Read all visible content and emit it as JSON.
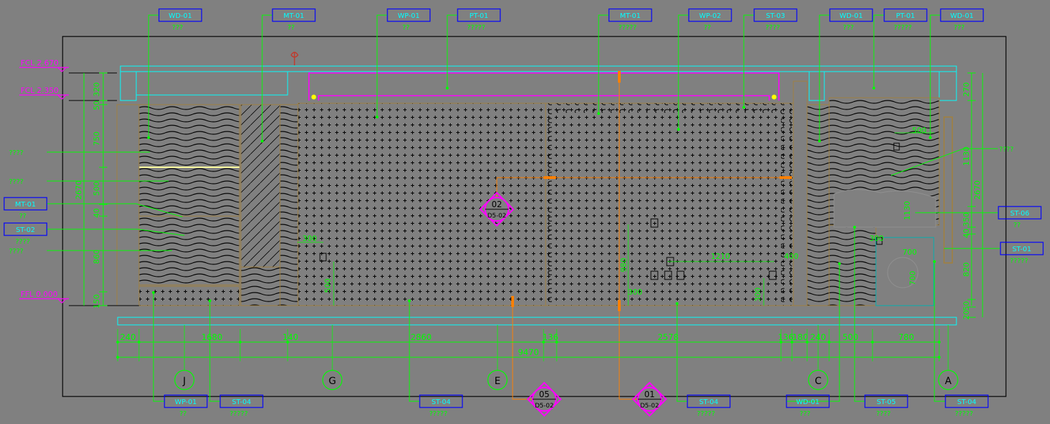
{
  "colors": {
    "background": "#808080",
    "frame": "#000000",
    "leader": "#00ff00",
    "tag_box": "#0000ff",
    "tag_text": "#00ffff",
    "level": "#ff00ff",
    "ceiling": "#00ffff",
    "grid_axis": "#ff8000",
    "wall_hatch": "#000000",
    "callout": "#ff00ff"
  },
  "top_tags": [
    {
      "code": "WD-01",
      "sub": "???"
    },
    {
      "code": "MT-01",
      "sub": "??"
    },
    {
      "code": "WP-01",
      "sub": "??"
    },
    {
      "code": "PT-01",
      "sub": "?????"
    },
    {
      "code": "MT-01",
      "sub": "?????"
    },
    {
      "code": "WP-02",
      "sub": "??"
    },
    {
      "code": "ST-03",
      "sub": "????"
    },
    {
      "code": "WD-01",
      "sub": "???"
    },
    {
      "code": "PT-01",
      "sub": "?????"
    },
    {
      "code": "WD-01",
      "sub": "???"
    }
  ],
  "bottom_tags": [
    {
      "code": "WP-01",
      "sub": "??"
    },
    {
      "code": "ST-04",
      "sub": "?????"
    },
    {
      "code": "ST-04",
      "sub": "?????"
    },
    {
      "code": "ST-04",
      "sub": "?????"
    },
    {
      "code": "WD-01",
      "sub": "???"
    },
    {
      "code": "ST-05",
      "sub": "????"
    },
    {
      "code": "ST-04",
      "sub": "?????"
    }
  ],
  "left_tags": [
    {
      "code": "MT-01",
      "sub": "??"
    },
    {
      "code": "ST-02",
      "sub": "????"
    }
  ],
  "right_tags": [
    {
      "code": "ST-06",
      "sub": "??"
    },
    {
      "code": "ST-01",
      "sub": "?????"
    }
  ],
  "left_notes": [
    "????",
    "????",
    "????"
  ],
  "right_notes": [
    "????"
  ],
  "levels": [
    {
      "label": "FCL 2.670"
    },
    {
      "label": "FCL 2.350"
    },
    {
      "label": "FFL 0.000"
    }
  ],
  "left_dims": [
    "320",
    "50",
    "750",
    "500",
    "40",
    "860",
    "150"
  ],
  "left_total": "2670",
  "right_dims": [
    "270",
    "1130",
    "350",
    "40",
    "820",
    "50",
    "20"
  ],
  "right_total": "2670",
  "bottom_dims": [
    "240",
    "1680",
    "140",
    "2860",
    "136",
    "2578",
    "136",
    "180",
    "240",
    "500",
    "780"
  ],
  "overall_dim": "9470",
  "inner_dims": [
    "300",
    "300",
    "500",
    "980",
    "1210",
    "400",
    "300",
    "300",
    "700",
    "700",
    "500",
    "1130"
  ],
  "grid_axes": [
    "J",
    "G",
    "E",
    "C",
    "A"
  ],
  "callouts": [
    {
      "num": "02",
      "sheet": "D5-02"
    },
    {
      "num": "05",
      "sheet": "D5-02"
    },
    {
      "num": "01",
      "sheet": "D5-02"
    }
  ]
}
